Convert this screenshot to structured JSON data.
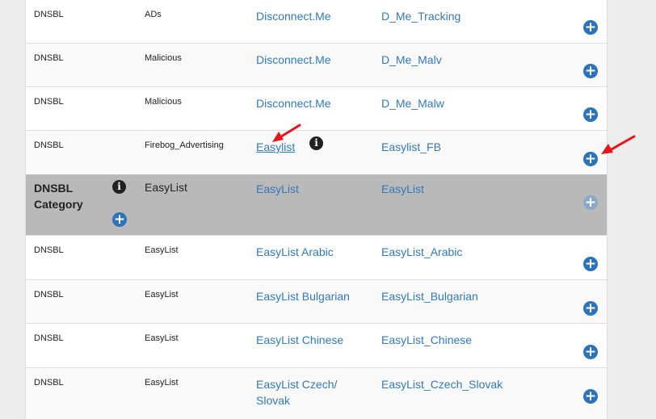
{
  "rows": [
    {
      "type": "DNSBL",
      "group": "ADs",
      "name": "Disconnect.Me",
      "alias": "D_Me_Tracking"
    },
    {
      "type": "DNSBL",
      "group": "Malicious",
      "name": "Disconnect.Me",
      "alias": "D_Me_Malv"
    },
    {
      "type": "DNSBL",
      "group": "Malicious",
      "name": "Disconnect.Me",
      "alias": "D_Me_Malw"
    },
    {
      "type": "DNSBL",
      "group": "Firebog_Advertising",
      "name": "Easylist",
      "alias": "Easylist_FB"
    },
    {
      "type": "DNSBL Category",
      "group": "EasyList",
      "name": "EasyList",
      "alias": "EasyList"
    },
    {
      "type": "DNSBL",
      "group": "EasyList",
      "name": "EasyList Arabic",
      "alias": "EasyList_Arabic"
    },
    {
      "type": "DNSBL",
      "group": "EasyList",
      "name": "EasyList Bulgarian",
      "alias": "EasyList_Bulgarian"
    },
    {
      "type": "DNSBL",
      "group": "EasyList",
      "name": "EasyList Chinese",
      "alias": "EasyList_Chinese"
    },
    {
      "type": "DNSBL",
      "group": "EasyList",
      "name": "EasyList Czech/ Slovak",
      "alias": "EasyList_Czech_Slovak"
    }
  ],
  "icons": {
    "add": "plus-circle-icon",
    "info": "info-circle-icon",
    "annotation": "red-arrow-icon"
  },
  "colors": {
    "link": "#3279b7",
    "button": "#2d73b9",
    "category_bg": "#b9b9b9",
    "arrow": "#e8141c"
  }
}
